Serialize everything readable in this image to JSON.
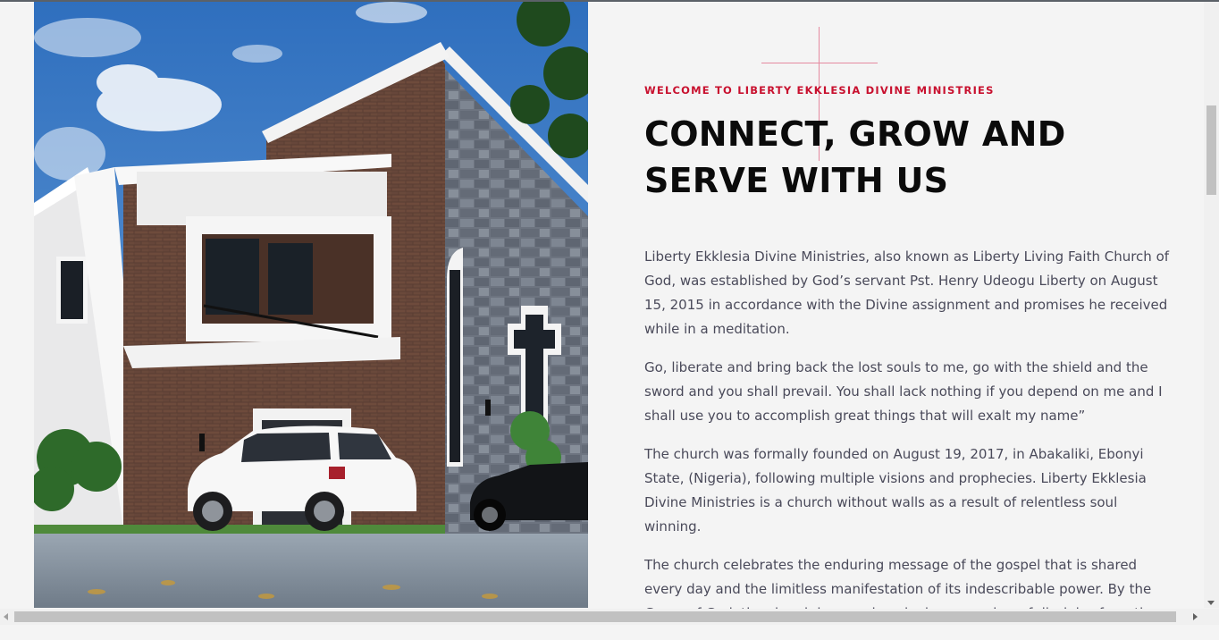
{
  "hero": {
    "image_alt": "church-building-render-image"
  },
  "content": {
    "eyebrow": "WELCOME TO LIBERTY EKKLESIA DIVINE MINISTRIES",
    "headline": "CONNECT, GROW AND SERVE WITH US",
    "paragraphs": [
      "Liberty Ekklesia Divine Ministries, also known as Liberty Living Faith Church of God, was established by God’s servant Pst. Henry Udeogu Liberty on August 15, 2015 in accordance with the Divine assignment and promises he received while in a meditation.",
      "Go, liberate and bring back the lost souls to me, go with the shield and the sword and you shall prevail. You shall lack nothing if you depend on me and I shall use you to accomplish great things that will exalt my name”",
      "The church was formally founded on August 19, 2017, in Abakaliki, Ebonyi State, (Nigeria), following multiple visions and prophecies. Liberty Ekklesia Divine Ministries is a church without walls as a result of relentless soul winning.",
      "The church celebrates the enduring message of the gospel that is shared every day and the limitless manifestation of its indescribable power. By the Grace of God, the church has produced a large number of disciples from the"
    ]
  },
  "colors": {
    "accent": "#c8102e",
    "cross": "#e58aa0",
    "heading": "#0b0b0b",
    "body_text": "#4a4a5a",
    "background": "#f4f4f4"
  }
}
